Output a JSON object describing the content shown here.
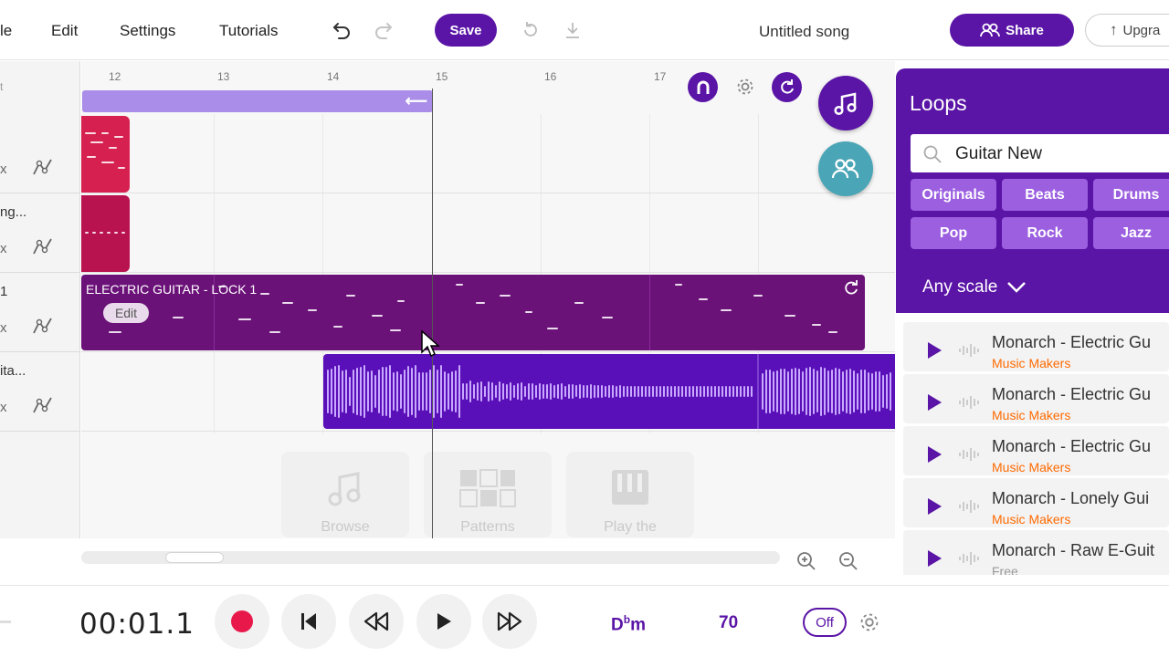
{
  "menu": {
    "file_partial": "le",
    "edit": "Edit",
    "settings": "Settings",
    "tutorials": "Tutorials"
  },
  "toolbar": {
    "save_label": "Save",
    "song_title": "Untitled song",
    "share_label": "Share",
    "upgrade_label": "Upgra"
  },
  "ruler": {
    "marks": [
      "12",
      "13",
      "14",
      "15",
      "16",
      "17"
    ],
    "partial_left": "t"
  },
  "tracks": [
    {
      "name": "",
      "mute": "x"
    },
    {
      "name": "ng...",
      "mute": "x"
    },
    {
      "name": "1",
      "mute": "x"
    },
    {
      "name": "ita...",
      "mute": "x"
    }
  ],
  "clips": {
    "guitar_title": "ELECTRIC GUITAR - LOCK 1",
    "edit_label": "Edit"
  },
  "empty_hints": {
    "browse": "Browse",
    "patterns": "Patterns",
    "play": "Play the"
  },
  "loops": {
    "title": "Loops",
    "search_value": "Guitar New",
    "filters": [
      "Originals",
      "Beats",
      "Drums",
      "Pop",
      "Rock",
      "Jazz"
    ],
    "scale": "Any scale",
    "items": [
      {
        "name": "Monarch - Electric Gu",
        "source": "Music Makers"
      },
      {
        "name": "Monarch - Electric Gu",
        "source": "Music Makers"
      },
      {
        "name": "Monarch - Electric Gu",
        "source": "Music Makers"
      },
      {
        "name": "Monarch - Lonely Gui",
        "source": "Music Makers"
      },
      {
        "name": "Monarch - Raw E-Guit",
        "source": "Free"
      }
    ]
  },
  "transport": {
    "time": "00:01.1",
    "key_root": "D",
    "key_accidental": "b",
    "key_mode": "m",
    "tempo": "70",
    "metronome": "Off"
  },
  "colors": {
    "accent": "#5a14a6",
    "loop_region": "#a98de8",
    "red_clip": "#d6204f",
    "guitar_clip": "#6b1279",
    "audio_clip": "#5a10b8",
    "teal": "#4aa5b6",
    "orange": "#ff6a00"
  }
}
